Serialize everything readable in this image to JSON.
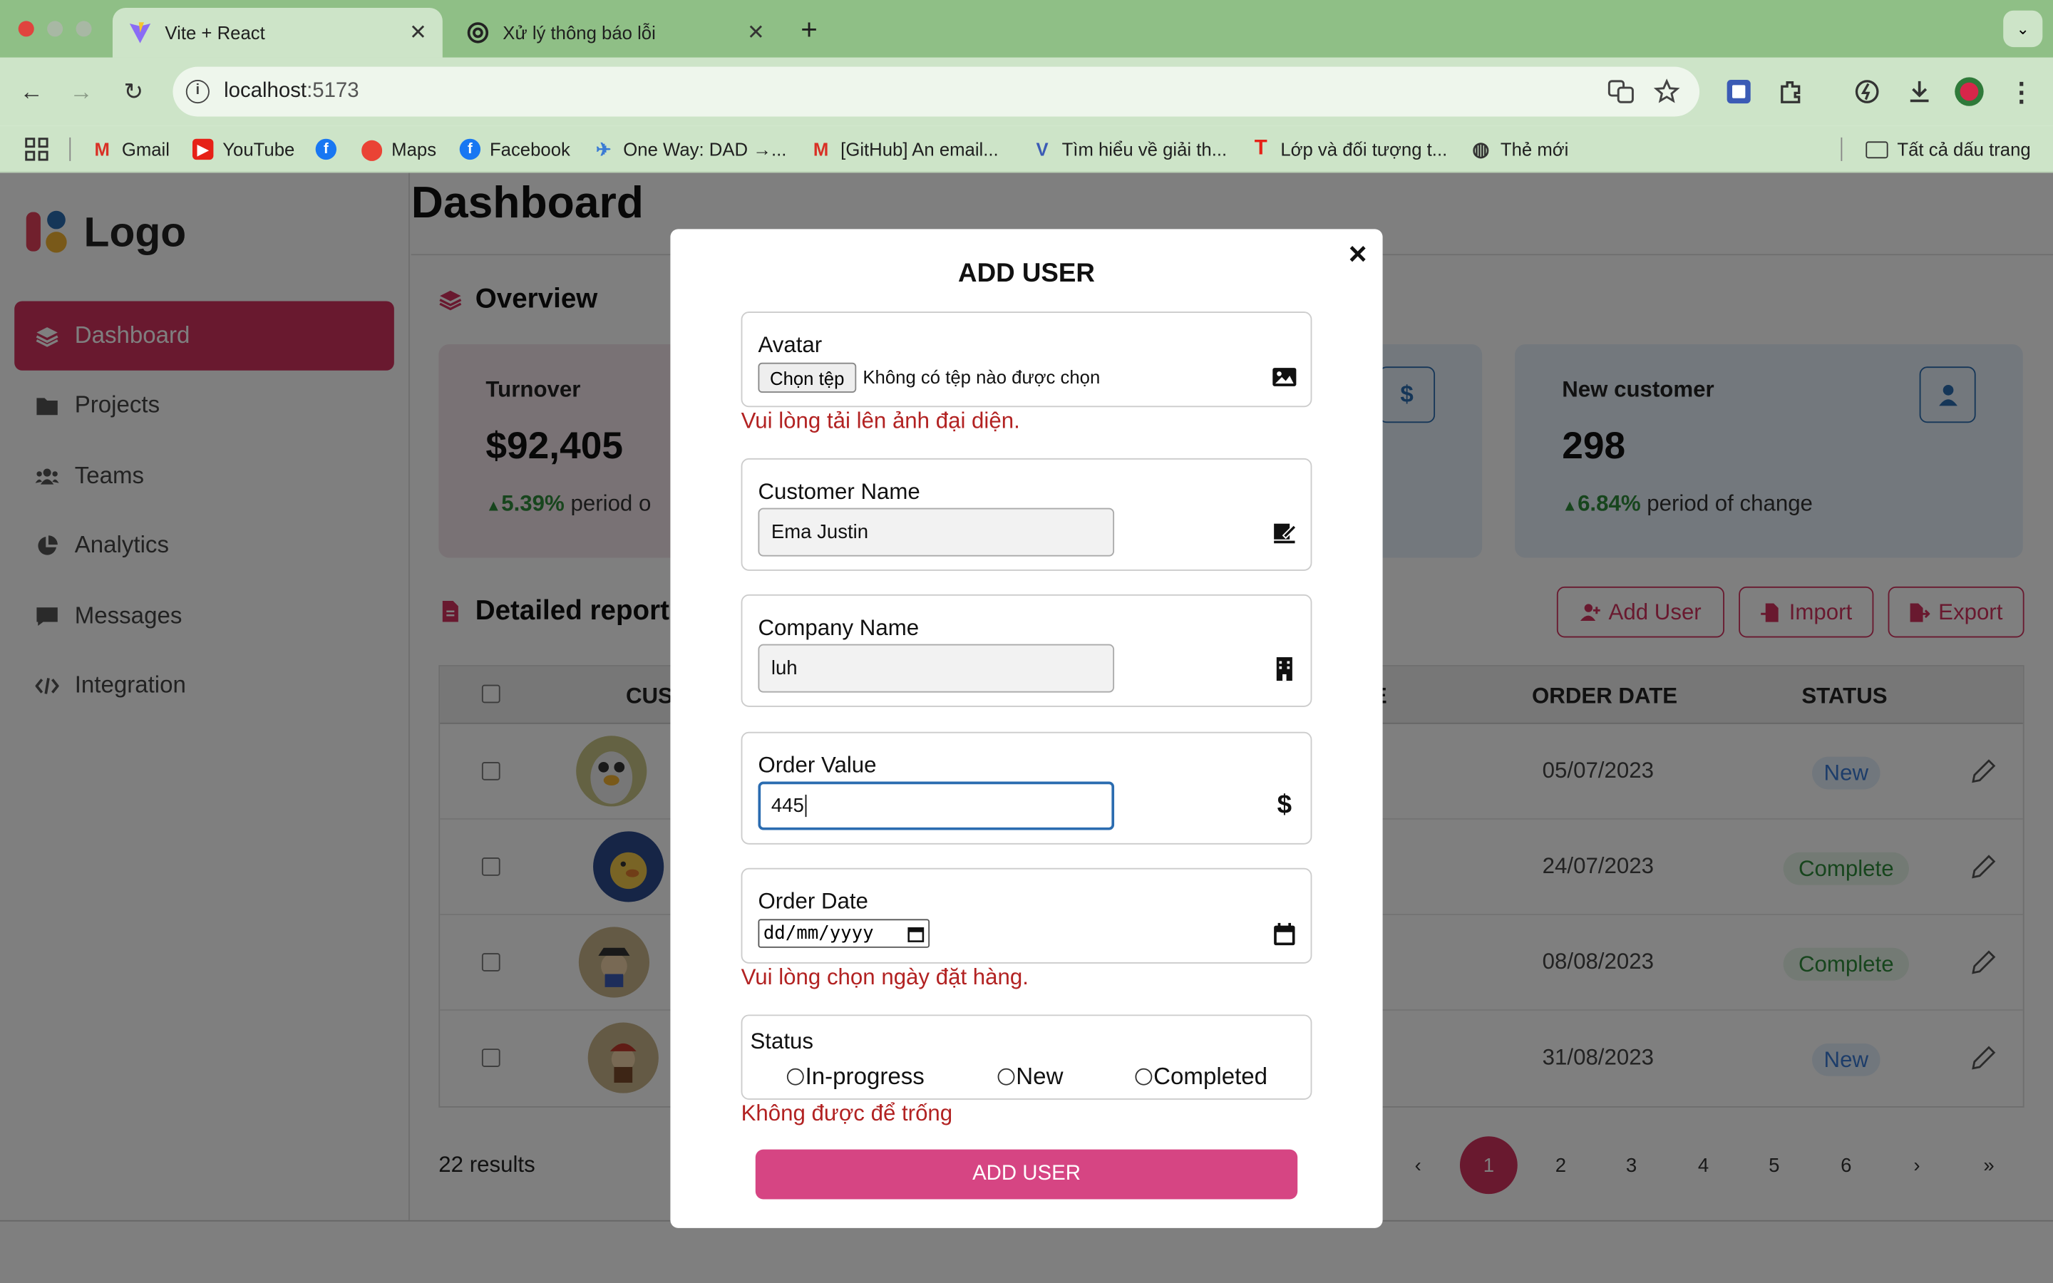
{
  "browser": {
    "tabs": [
      {
        "title": "Vite + React",
        "active": true
      },
      {
        "title": "Xử lý thông báo lỗi",
        "active": false
      }
    ],
    "url_host": "localhost",
    "url_port": ":5173",
    "bookmarks": [
      {
        "label": "Gmail"
      },
      {
        "label": "YouTube"
      },
      {
        "label": "Maps"
      },
      {
        "label": "Facebook"
      },
      {
        "label": "One Way: DAD →..."
      },
      {
        "label": "[GitHub] An email..."
      },
      {
        "label": "Tìm hiểu về giải th..."
      },
      {
        "label": "Lớp và đối tượng t..."
      },
      {
        "label": "Thẻ mới"
      }
    ],
    "all_bookmarks": "Tất cả dấu trang"
  },
  "app": {
    "logo": "Logo",
    "sidebar": [
      {
        "label": "Dashboard",
        "icon": "layers-icon",
        "active": true
      },
      {
        "label": "Projects",
        "icon": "folder-icon"
      },
      {
        "label": "Teams",
        "icon": "users-icon"
      },
      {
        "label": "Analytics",
        "icon": "pie-chart-icon"
      },
      {
        "label": "Messages",
        "icon": "message-icon"
      },
      {
        "label": "Integration",
        "icon": "code-icon"
      }
    ],
    "page_title": "Dashboard",
    "overview_title": "Overview",
    "cards": [
      {
        "title": "Turnover",
        "value": "$92,405",
        "change": "5.39%",
        "change_text": "period o",
        "bg": "#f2e4ea"
      },
      {
        "title": "New customer",
        "value": "298",
        "change": "6.84%",
        "change_text": "period of change",
        "bg": "#e6f0fa"
      }
    ],
    "report_title": "Detailed report",
    "actions": {
      "add_user": "Add User",
      "import": "Import",
      "export": "Export"
    },
    "table": {
      "headers": {
        "customer": "CUS",
        "value_tail": "E",
        "order_date": "ORDER DATE",
        "status": "STATUS"
      },
      "rows": [
        {
          "date": "05/07/2023",
          "status": "New"
        },
        {
          "date": "24/07/2023",
          "status": "Complete"
        },
        {
          "date": "08/08/2023",
          "status": "Complete"
        },
        {
          "date": "31/08/2023",
          "status": "New"
        }
      ]
    },
    "results": "22 results",
    "pagination": [
      "‹",
      "1",
      "2",
      "3",
      "4",
      "5",
      "6",
      "›",
      "»"
    ]
  },
  "modal": {
    "close": "×",
    "title": "ADD USER",
    "avatar_label": "Avatar",
    "file_button": "Chọn tệp",
    "file_status": "Không có tệp nào được chọn",
    "avatar_error": "Vui lòng tải lên ảnh đại diện.",
    "customer_label": "Customer Name",
    "customer_value": "Ema Justin",
    "company_label": "Company Name",
    "company_value": "luh",
    "order_value_label": "Order Value",
    "order_value": "445",
    "order_date_label": "Order Date",
    "order_date_placeholder": "dd/mm/yyyy",
    "order_date_error": "Vui lòng chọn ngày đặt hàng.",
    "status_label": "Status",
    "status_options": [
      "In-progress",
      "New",
      "Completed"
    ],
    "status_error": "Không được để trống",
    "submit": "ADD USER"
  },
  "colors": {
    "accent": "#d2335f",
    "submit": "#d64583",
    "error": "#b22222",
    "tab_bar": "#8fbf86"
  }
}
